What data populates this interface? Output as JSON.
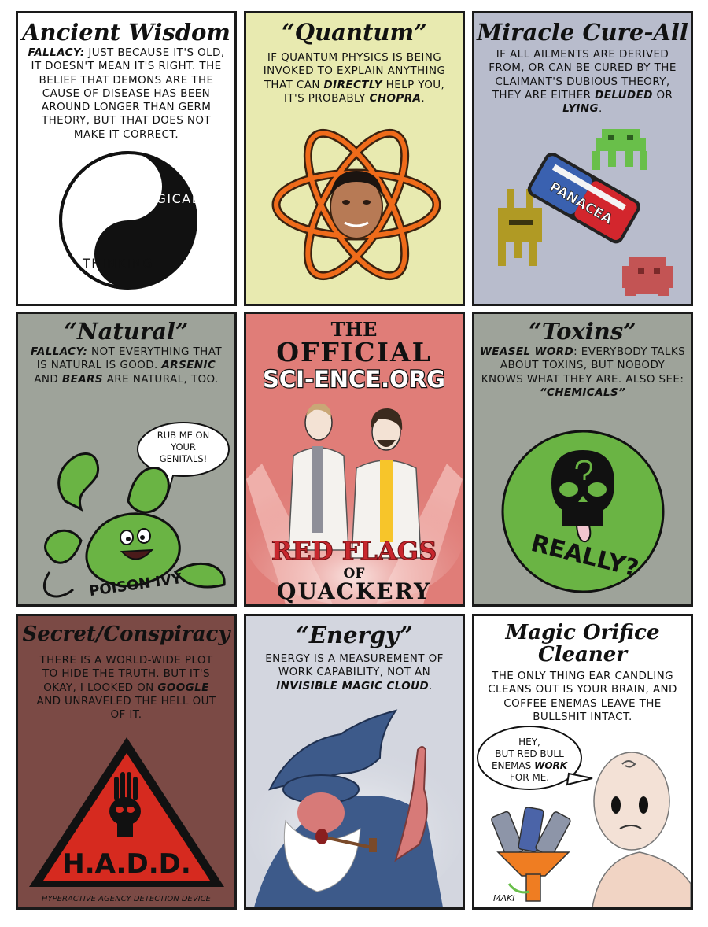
{
  "panels": {
    "ancient": {
      "title": "Ancient Wisdom",
      "lead": "FALLACY:",
      "text": " JUST BECAUSE IT'S OLD, IT DOESN'T MEAN IT'S RIGHT. THE BELIEF THAT DEMONS ARE THE CAUSE OF DISEASE HAS BEEN AROUND LONGER THAN GERM THEORY, BUT THAT DOES NOT MAKE IT CORRECT.",
      "art_words": [
        "MAGICAL",
        "THINKING"
      ]
    },
    "quantum": {
      "title": "“Quantum”",
      "t1": "IF QUANTUM PHYSICS IS BEING INVOKED TO EXPLAIN ANYTHING THAT CAN ",
      "t2": "DIRECTLY",
      "t3": " HELP YOU, IT'S PROBABLY ",
      "t4": "CHOPRA",
      "t5": "."
    },
    "miracle": {
      "title": "Miracle Cure-All",
      "t1": "IF ALL AILMENTS ARE DERIVED FROM, OR CAN BE CURED BY THE CLAIMANT'S DUBIOUS THEORY, THEY ARE EITHER ",
      "t2": "DELUDED",
      "t3": " OR ",
      "t4": "LYING",
      "t5": ".",
      "pill_label": "PANACEA"
    },
    "natural": {
      "title": "“Natural”",
      "lead": "FALLACY:",
      "t1": " NOT EVERYTHING THAT IS NATURAL IS GOOD. ",
      "t2": "ARSENIC",
      "t3": " AND ",
      "t4": "BEARS",
      "t5": " ARE NATURAL, TOO.",
      "bubble_l1": "RUB ME ON",
      "bubble_l2": "YOUR",
      "bubble_l3": "GENITALS!",
      "ivy_label": "POISON IVY"
    },
    "center": {
      "the": "THE",
      "official": "OFFICIAL",
      "site": "SCI-ENCE.ORG",
      "red_flags": "RED FLAGS",
      "of": "OF",
      "quackery": "QUACKERY"
    },
    "toxins": {
      "title": "“Toxins”",
      "lead": "WEASEL WORD",
      "t1": ": EVERYBODY TALKS ABOUT TOXINS, BUT NOBODY KNOWS WHAT THEY ARE. ALSO SEE: ",
      "t2": "“CHEMICALS”",
      "seal_text": "REALLY?"
    },
    "secret": {
      "title": "Secret/Conspiracy",
      "t1": "THERE IS A WORLD-WIDE PLOT TO HIDE THE TRUTH. BUT IT'S OKAY, I LOOKED ON ",
      "t2": "GOOGLE",
      "t3": " AND UNRAVELED THE HELL OUT OF IT.",
      "sign": "H.A.D.D.",
      "caption": "HYPERACTIVE AGENCY DETECTION DEVICE"
    },
    "energy": {
      "title": "“Energy”",
      "t1": "ENERGY IS A MEASUREMENT OF WORK CAPABILITY, NOT AN ",
      "t2": "INVISIBLE MAGIC CLOUD",
      "t3": "."
    },
    "orifice": {
      "title_l1": "Magic Orifice",
      "title_l2": "Cleaner",
      "text": "THE ONLY THING EAR CANDLING CLEANS OUT IS YOUR BRAIN, AND COFFEE ENEMAS LEAVE THE BULLSHIT INTACT.",
      "b1": "HEY,",
      "b2": "BUT RED BULL",
      "b3": "ENEMAS ",
      "b3em": "WORK",
      "b4": "FOR ME.",
      "signature": "MAKI"
    }
  },
  "colors": {
    "ancient_bg": "#ffffff",
    "quantum_bg": "#e8eab0",
    "miracle_bg": "#b8bccc",
    "natural_bg": "#9ea39a",
    "center_bg": "#e07d78",
    "toxins_bg": "#9ea39a",
    "secret_bg": "#7b4a45",
    "energy_bg": "#d3d6df",
    "orifice_bg": "#ffffff",
    "green": "#6ab444",
    "atom_orange": "#ef6b1a"
  }
}
